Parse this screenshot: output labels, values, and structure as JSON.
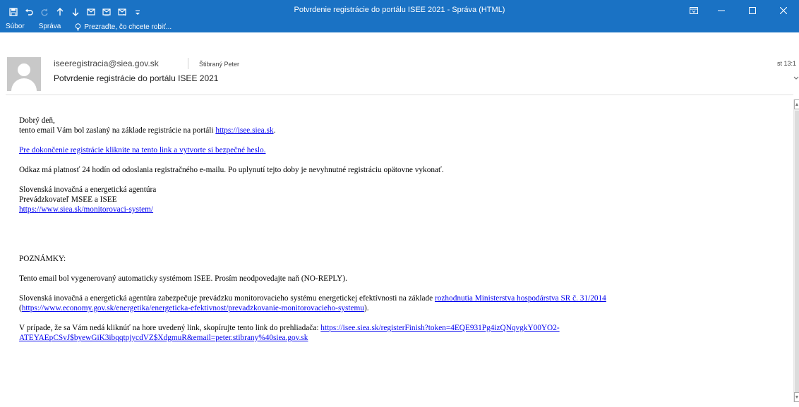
{
  "window": {
    "title": "Potvrdenie registrácie do portálu ISEE 2021 - Správa (HTML)",
    "accent_color": "#1a72c4"
  },
  "quick_access": [
    {
      "icon": "save-icon"
    },
    {
      "icon": "undo-icon"
    },
    {
      "icon": "redo-icon"
    },
    {
      "icon": "previous-item-icon"
    },
    {
      "icon": "next-item-icon"
    },
    {
      "icon": "reply-icon"
    },
    {
      "icon": "reply-all-icon"
    },
    {
      "icon": "forward-icon"
    },
    {
      "icon": "customize-toolbar-icon"
    }
  ],
  "ribbon": {
    "tabs": [
      "Súbor",
      "Správa"
    ],
    "tell_me": "Prezraďte, čo chcete robiť..."
  },
  "message": {
    "from": "iseeregistracia@siea.gov.sk",
    "to": "Štibraný Peter",
    "subject": "Potvrdenie registrácie do portálu ISEE 2021",
    "time": "st 13:1"
  },
  "body": {
    "greeting": "Dobrý deň,",
    "intro": "tento email Vám bol zaslaný na základe registrácie na portáli ",
    "intro_link": "https://isee.siea.sk",
    "intro_end": ".",
    "finish_link": "Pre dokončenie registrácie kliknite na tento link a vytvorte si bezpečné heslo.",
    "validity": "Odkaz má platnosť 24 hodín od odoslania registračného e-mailu. Po uplynutí tejto doby je nevyhnutné registráciu opätovne vykonať.",
    "sig_org": "Slovenská inovačná a energetická agentúra",
    "sig_role": "Prevádzkovateľ MSEE a ISEE",
    "sig_link": "https://www.siea.sk/monitorovaci-system/",
    "notes_heading": "POZNÁMKY:",
    "note_noreply": "Tento email bol vygenerovaný automaticky systémom ISEE. Prosím neodpovedajte naň (NO-REPLY).",
    "note_operation": "Slovenská inovačná a energetická agentúra zabezpečuje prevádzku monitorovacieho systému energetickej efektívnosti na základe ",
    "note_decision_link": "rozhodnutia Ministerstva hospodárstva SR č. 31/2014",
    "note_open_paren": "(",
    "note_economy_link": "https://www.economy.gov.sk/energetika/energeticka-efektivnost/prevadzkovanie-monitorovacieho-systemu",
    "note_close_paren": ").",
    "note_copy": "V prípade, že sa Vám nedá kliknúť na hore uvedený link, skopírujte tento link do prehliadača: ",
    "note_token_link_1": "https://isee.siea.sk/registerFinish?token=4EQE931Pg4izQNqvgkY00YO2-",
    "note_token_link_2": "ATEYAEpCSvJ$byewGiK3ibqqtpjycdVZ$XdgmuR&email=peter.stibrany%40siea.gov.sk"
  }
}
